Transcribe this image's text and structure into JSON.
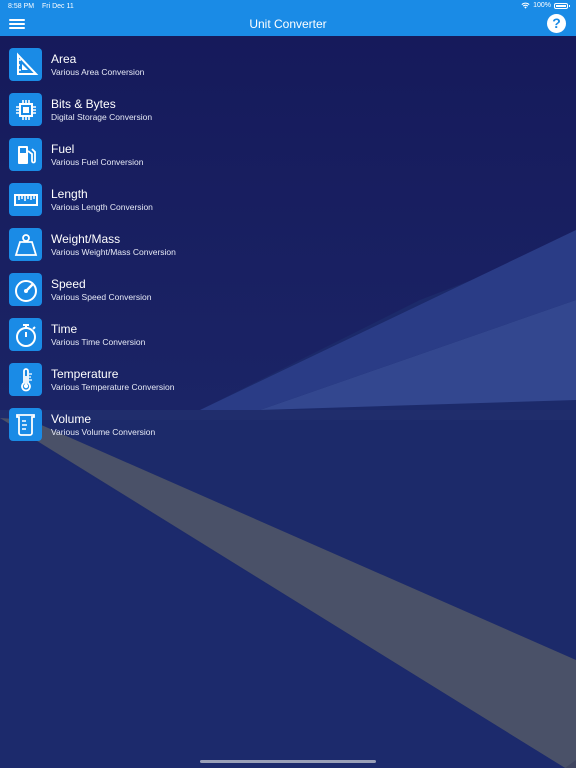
{
  "status_bar": {
    "time": "8:58 PM",
    "date": "Fri Dec 11",
    "battery": "100%"
  },
  "nav": {
    "title": "Unit Converter",
    "help_label": "?"
  },
  "colors": {
    "accent": "#1a8be6",
    "background": "#16205a"
  },
  "items": [
    {
      "name": "Area",
      "desc": "Various Area Conversion",
      "icon": "set-square-icon"
    },
    {
      "name": "Bits & Bytes",
      "desc": "Digital Storage Conversion",
      "icon": "chip-icon"
    },
    {
      "name": "Fuel",
      "desc": "Various Fuel Conversion",
      "icon": "fuel-pump-icon"
    },
    {
      "name": "Length",
      "desc": "Various Length Conversion",
      "icon": "ruler-icon"
    },
    {
      "name": "Weight/Mass",
      "desc": "Various Weight/Mass Conversion",
      "icon": "weight-icon"
    },
    {
      "name": "Speed",
      "desc": "Various Speed Conversion",
      "icon": "speedometer-icon"
    },
    {
      "name": "Time",
      "desc": "Various Time Conversion",
      "icon": "stopwatch-icon"
    },
    {
      "name": "Temperature",
      "desc": "Various Temperature Conversion",
      "icon": "thermometer-icon"
    },
    {
      "name": "Volume",
      "desc": "Various Volume Conversion",
      "icon": "beaker-icon"
    }
  ]
}
